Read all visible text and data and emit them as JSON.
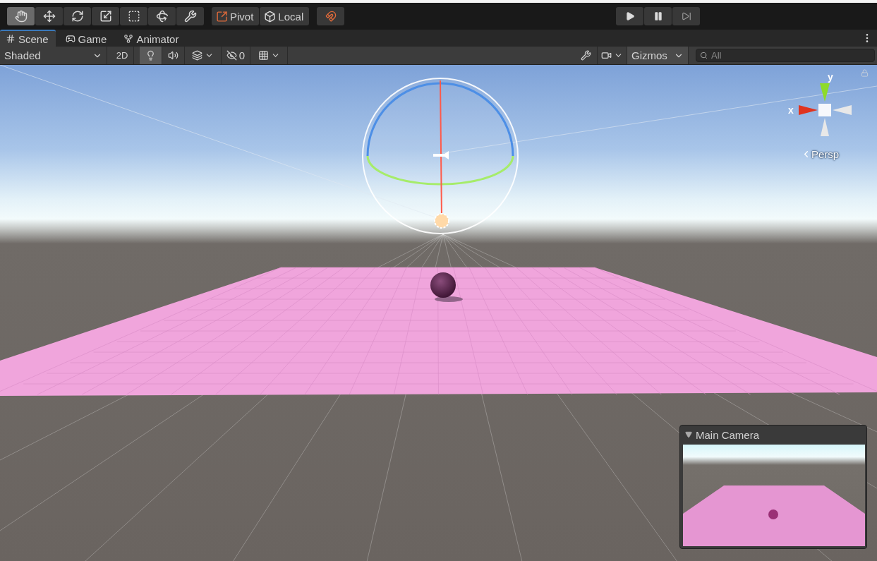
{
  "toolbar": {
    "tools": [
      {
        "kind": "hand",
        "selected": true
      },
      {
        "kind": "move",
        "selected": false
      },
      {
        "kind": "rotate",
        "selected": false
      },
      {
        "kind": "scale",
        "selected": false
      },
      {
        "kind": "rect",
        "selected": false
      },
      {
        "kind": "transform",
        "selected": false
      },
      {
        "kind": "custom",
        "selected": false
      }
    ],
    "handle_buttons": [
      {
        "kind": "pivot",
        "label": "Pivot"
      },
      {
        "kind": "local",
        "label": "Local"
      }
    ]
  },
  "tabs": [
    {
      "kind": "scene",
      "label": "Scene",
      "selected": true
    },
    {
      "kind": "game",
      "label": "Game",
      "selected": false
    },
    {
      "kind": "animator",
      "label": "Animator",
      "selected": false
    }
  ],
  "scene_toolbar": {
    "draw_mode": "Shaded",
    "mode_2d": {
      "label": "2D",
      "on": false
    },
    "lighting_on": true,
    "hidden_count": "0",
    "gizmos": "Gizmos",
    "search": {
      "placeholder": "All"
    }
  },
  "orientation_gizmo": {
    "x_label": "x",
    "y_label": "y",
    "projection": "Persp"
  },
  "camera_preview": {
    "title": "Main Camera",
    "expanded": true
  }
}
